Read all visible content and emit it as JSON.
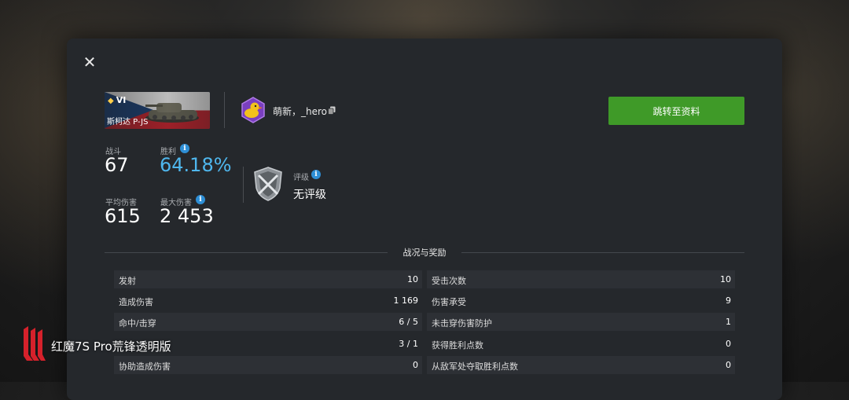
{
  "header": {
    "close_symbol": "✕",
    "tank": {
      "tier": "VI",
      "name": "斯柯达 P-JS"
    },
    "player": {
      "name": "萌新，_hero"
    },
    "profile_button": "跳转至资料"
  },
  "stats": {
    "battles": {
      "label": "战斗",
      "value": "67"
    },
    "winrate": {
      "label": "胜利",
      "value": "64.18%"
    },
    "avg_damage": {
      "label": "平均伤害",
      "value": "615"
    },
    "max_damage": {
      "label": "最大伤害",
      "value": "2 453"
    },
    "rating": {
      "label": "评级",
      "value": "无评级"
    },
    "info_glyph": "i"
  },
  "section": {
    "title": "战况与奖励"
  },
  "left_rows": [
    {
      "label": "发射",
      "value": "10"
    },
    {
      "label": "造成伤害",
      "value": "1 169"
    },
    {
      "label": "命中/击穿",
      "value": "6 / 5"
    },
    {
      "label": "",
      "value": "3 / 1"
    },
    {
      "label": "协助造成伤害",
      "value": "0"
    }
  ],
  "right_rows": [
    {
      "label": "受击次数",
      "value": "10"
    },
    {
      "label": "伤害承受",
      "value": "9"
    },
    {
      "label": "未击穿伤害防护",
      "value": "1"
    },
    {
      "label": "获得胜利点数",
      "value": "0"
    },
    {
      "label": "从敌军处夺取胜利点数",
      "value": "0"
    }
  ],
  "watermark": {
    "text": "红魔7S Pro荒锋透明版"
  },
  "colors": {
    "accent_green": "#3f9a28",
    "accent_blue": "#4fb7ee",
    "panel": "#25282c",
    "brand_red": "#d6212b"
  },
  "icons": [
    "close-icon",
    "tier-icon",
    "copy-icon",
    "info-icon",
    "rating-shield-icon",
    "duck-avatar-icon",
    "redmagic-logo-icon"
  ]
}
